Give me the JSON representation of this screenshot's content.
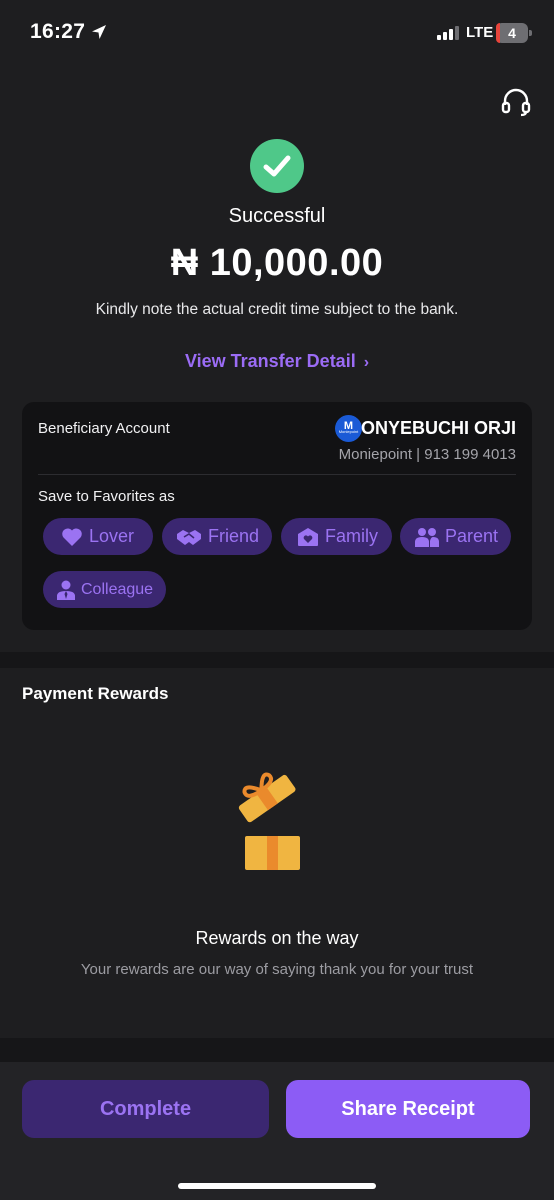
{
  "status_bar": {
    "time": "16:27",
    "network": "LTE",
    "battery": "4"
  },
  "header": {
    "support_icon": "headset-icon"
  },
  "result": {
    "status": "Successful",
    "amount": "₦ 10,000.00",
    "note": "Kindly note the actual credit time subject to the bank.",
    "detail_link": "View Transfer Detail",
    "accent_color": "#9b6cf5",
    "success_color": "#4fc889"
  },
  "beneficiary": {
    "label": "Beneficiary Account",
    "bank_logo_letter": "M",
    "bank_logo_text": "Moniepoint",
    "name": "ONYEBUCHI ORJI",
    "account": "Moniepoint | 913 199 4013"
  },
  "favorites": {
    "label": "Save to Favorites as",
    "options": [
      {
        "label": "Lover",
        "icon": "heart-icon"
      },
      {
        "label": "Friend",
        "icon": "handshake-icon"
      },
      {
        "label": "Family",
        "icon": "home-heart-icon"
      },
      {
        "label": "Parent",
        "icon": "people-icon"
      },
      {
        "label": "Colleague",
        "icon": "person-icon"
      }
    ]
  },
  "rewards": {
    "title": "Payment Rewards",
    "icon": "gift-icon",
    "heading": "Rewards on the way",
    "subtext": "Your rewards are our way of saying thank you for your trust"
  },
  "actions": {
    "complete": "Complete",
    "share": "Share Receipt"
  }
}
